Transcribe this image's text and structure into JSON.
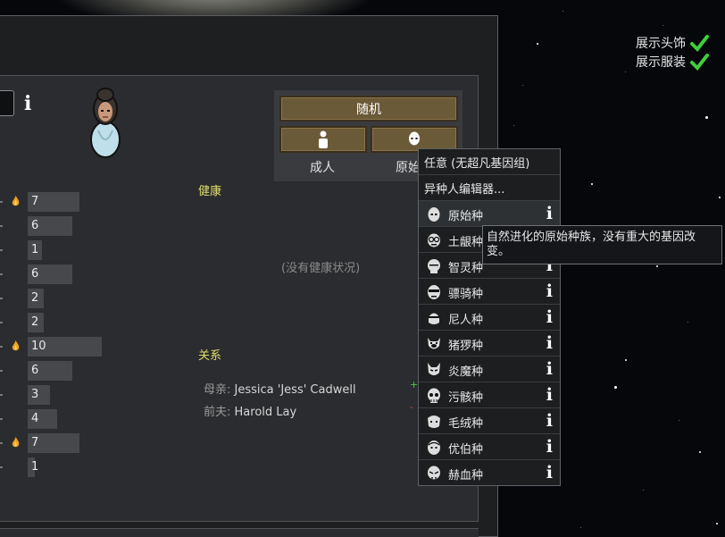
{
  "toggles": [
    {
      "label": "展示头饰",
      "checked": true
    },
    {
      "label": "展示服装",
      "checked": true
    }
  ],
  "buttons": {
    "random": "随机",
    "adult_caption": "成人",
    "xeno_caption": "原始种"
  },
  "stats": [
    {
      "value": "7",
      "passion": true
    },
    {
      "value": "6",
      "passion": false
    },
    {
      "value": "1",
      "passion": false
    },
    {
      "value": "6",
      "passion": false
    },
    {
      "value": "2",
      "passion": false
    },
    {
      "value": "2",
      "passion": false
    },
    {
      "value": "10",
      "passion": true
    },
    {
      "value": "6",
      "passion": false
    },
    {
      "value": "3",
      "passion": false
    },
    {
      "value": "4",
      "passion": false
    },
    {
      "value": "7",
      "passion": true
    },
    {
      "value": "1",
      "passion": false
    }
  ],
  "health": {
    "title": "健康",
    "empty": "(没有健康状况)"
  },
  "relations": {
    "title": "关系",
    "items": [
      {
        "key": "母亲:",
        "name": "Jessica 'Jess' Cadwell"
      },
      {
        "key": "前夫:",
        "name": "Harold Lay"
      }
    ]
  },
  "dropdown": {
    "any": "任意 (无超凡基因组)",
    "editor": "异种人编辑器...",
    "xenotypes": [
      {
        "label": "原始种",
        "icon": "baseliner-icon"
      },
      {
        "label": "土龈种",
        "icon": "dirtmole-icon"
      },
      {
        "label": "智灵种",
        "icon": "genie-icon"
      },
      {
        "label": "骠骑种",
        "icon": "hussar-icon"
      },
      {
        "label": "尼人种",
        "icon": "neanderthal-icon"
      },
      {
        "label": "猪猡种",
        "icon": "pigskin-icon"
      },
      {
        "label": "炎魔种",
        "icon": "impid-icon"
      },
      {
        "label": "污骸种",
        "icon": "waster-icon"
      },
      {
        "label": "毛绒种",
        "icon": "yttakin-icon"
      },
      {
        "label": "优伯种",
        "icon": "highmate-icon"
      },
      {
        "label": "赫血种",
        "icon": "sanguophage-icon"
      }
    ]
  },
  "tooltip": "自然进化的原始种族，没有重大的基因改变。",
  "colors": {
    "accent_yellow": "#dede6a",
    "button_gold": "#6b5a38",
    "check_green": "#3fce3a"
  }
}
